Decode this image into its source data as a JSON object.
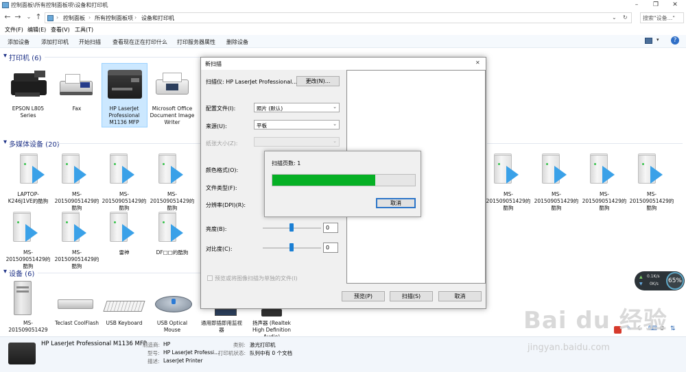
{
  "window": {
    "title": "控制面板\\所有控制面板项\\设备和打印机",
    "controls": [
      "–",
      "❐",
      "✕"
    ]
  },
  "address": {
    "crumbs": [
      "控制面板",
      "所有控制面板项",
      "设备和打印机"
    ],
    "search_placeholder": "搜索\"设备...\""
  },
  "menu": [
    "文件(F)",
    "编辑(E)",
    "查看(V)",
    "工具(T)"
  ],
  "commands": [
    "添加设备",
    "添加打印机",
    "开始扫描",
    "查看现在正在打印什么",
    "打印服务器属性",
    "删除设备"
  ],
  "groups": {
    "printers": "打印机 (6)",
    "media": "多媒体设备 (20)",
    "devices": "设备 (6)"
  },
  "printers": [
    {
      "label": "EPSON L805 Series",
      "icon": "epson-printer-icon"
    },
    {
      "label": "Fax",
      "icon": "fax-icon"
    },
    {
      "label": "HP LaserJet Professional M1136 MFP",
      "icon": "hp-mfp-icon",
      "selected": true
    },
    {
      "label": "Microsoft Office Document Image Writer",
      "icon": "document-writer-icon"
    }
  ],
  "media_row1_left": [
    "LAPTOP-K246J1VE的酷狗",
    "MS-201509051429的酷狗",
    "MS-201509051429的酷狗",
    "MS-201509051429的酷狗"
  ],
  "media_row1_right": [
    "MS-201509051429的酷狗",
    "MS-201509051429的酷狗",
    "MS-201509051429的酷狗",
    "MS-201509051429的酷狗"
  ],
  "media_row2": [
    "MS-201509051429的酷狗",
    "MS-201509051429的酷狗",
    "雷神",
    "DF□□的酷狗"
  ],
  "devices": [
    {
      "label": "MS-201509051429",
      "icon": "computer-icon"
    },
    {
      "label": "Teclast CoolFlash",
      "icon": "usb-drive-icon"
    },
    {
      "label": "USB Keyboard",
      "icon": "keyboard-icon"
    },
    {
      "label": "USB Optical Mouse",
      "icon": "mouse-icon"
    },
    {
      "label": "通用即插即用监视器",
      "icon": "monitor-icon"
    },
    {
      "label": "扬声器 (Realtek High Definition Audio)",
      "icon": "speaker-icon"
    }
  ],
  "details": {
    "name": "HP LaserJet Professional M1136 MFP",
    "manufacturer_label": "制造商:",
    "manufacturer": "HP",
    "model_label": "型号:",
    "model": "HP LaserJet Professi...",
    "description_label": "描述:",
    "description": "LaserJet Printer",
    "category_label": "类别:",
    "category": "激光打印机",
    "status_label": "打印机状态:",
    "status": "队列中有 0 个文档"
  },
  "scan_dialog": {
    "title": "新扫描",
    "scanner_label": "扫描仪: HP LaserJet Professional...",
    "change_button": "更改(N)...",
    "profile_label": "配置文件(I):",
    "profile_value": "照片 (默认)",
    "source_label": "来源(U):",
    "source_value": "平板",
    "paper_label": "纸张大小(Z):",
    "paper_value": "",
    "color_label": "颜色格式(O):",
    "filetype_label": "文件类型(F):",
    "dpi_label": "分辨率(DPI)(R):",
    "brightness_label": "亮度(B):",
    "brightness_value": "0",
    "contrast_label": "对比度(C):",
    "contrast_value": "0",
    "separate_files": "预览或将图像扫描为单独的文件(I)",
    "preview_button": "预览(P)",
    "scan_button": "扫描(S)",
    "cancel_button": "取消",
    "close_icon": "✕"
  },
  "scan_progress": {
    "pages_label": "扫描页数: 1",
    "cancel_button": "取消",
    "progress_fraction": 0.72
  },
  "network_widget": {
    "up": "0.1K/s",
    "down": "0K/s",
    "percent": "65%"
  },
  "watermark": {
    "brand": "Bai du 经验",
    "url": "jingyan.baidu.com"
  },
  "colors": {
    "progress": "#06b025",
    "group_header": "#1e3287",
    "primary_border": "#2a74c8"
  }
}
